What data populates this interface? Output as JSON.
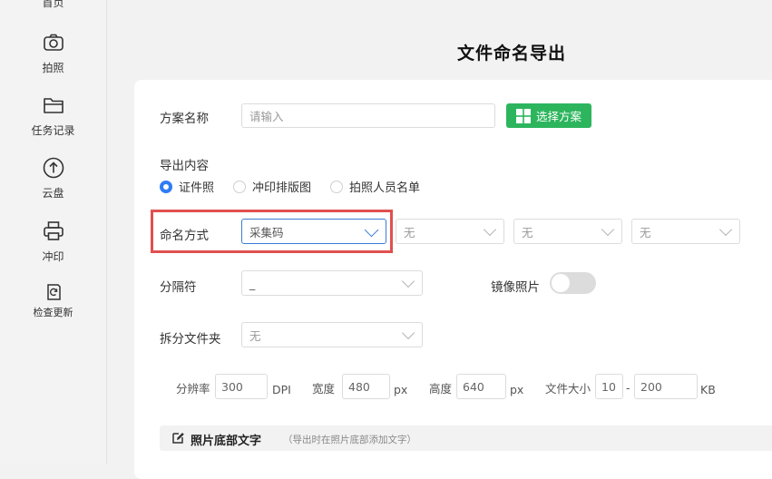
{
  "sidebar": {
    "items": [
      {
        "label": "首页",
        "icon": "home-icon"
      },
      {
        "label": "拍照",
        "icon": "camera-icon"
      },
      {
        "label": "任务记录",
        "icon": "folder-icon"
      },
      {
        "label": "云盘",
        "icon": "upload-icon"
      },
      {
        "label": "冲印",
        "icon": "printer-icon"
      },
      {
        "label": "检查更新",
        "icon": "refresh-icon"
      }
    ]
  },
  "page": {
    "title": "文件命名导出"
  },
  "form": {
    "scheme_label": "方案名称",
    "scheme_placeholder": "请输入",
    "choose_scheme_button": "选择方案",
    "export_label": "导出内容",
    "export_options": [
      "证件照",
      "冲印排版图",
      "拍照人员名单"
    ],
    "export_selected": "证件照",
    "naming_label": "命名方式",
    "naming_values": [
      "采集码",
      "无",
      "无",
      "无"
    ],
    "separator_label": "分隔符",
    "separator_value": "_",
    "mirror_label": "镜像照片",
    "mirror_on": false,
    "split_label": "拆分文件夹",
    "split_value": "无"
  },
  "size": {
    "resolution_label": "分辨率",
    "resolution_value": "300",
    "resolution_unit": "DPI",
    "width_label": "宽度",
    "width_value": "480",
    "width_unit": "px",
    "height_label": "高度",
    "height_value": "640",
    "height_unit": "px",
    "filesize_label": "文件大小",
    "filesize_min": "10",
    "filesize_sep": "-",
    "filesize_max": "200",
    "filesize_unit": "KB"
  },
  "footer_section": {
    "title": "照片底部文字",
    "note": "（导出时在照片底部添加文字）"
  },
  "colors": {
    "accent": "#2f7cf6",
    "green": "#2db55d",
    "highlight": "#e0504f"
  }
}
